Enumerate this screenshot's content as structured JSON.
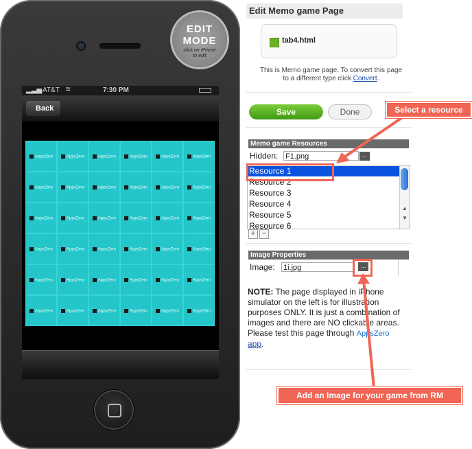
{
  "phone": {
    "status_carrier": "AT&T",
    "status_time": "7:30 PM",
    "back_label": "Back",
    "edit_seal_big1": "EDIT",
    "edit_seal_big2": "MODE",
    "edit_seal_small1": "click on iPhone",
    "edit_seal_small2": "to edit",
    "tile_brand": "AppsZero",
    "tile_count": 36
  },
  "panel": {
    "title": "Edit Memo game Page",
    "file_name": "tab4.html",
    "desc_text": "This is Memo game page. To convert this page to a different type click",
    "desc_link": "Convert",
    "save_label": "Save",
    "done_label": "Done"
  },
  "resources": {
    "header": "Memo game Resources",
    "hidden_label": "Hidden:",
    "hidden_value": "F1.png",
    "dots_label": "...",
    "items": [
      "Resource 1",
      "Resource 2",
      "Resource 3",
      "Resource 4",
      "Resource 5",
      "Resource 6"
    ],
    "selected_index": 0
  },
  "image_props": {
    "header": "Image Properties",
    "image_label": "Image:",
    "image_value": "1i.jpg",
    "dots_label": "..."
  },
  "note": {
    "bold": "NOTE:",
    "text": "The page displayed in iPhone simulator on the left is for illustration purposes ONLY. It is just a combination of images and there are NO clickable areas. Please test this page through",
    "brand": "AppsZero",
    "app_link": "app",
    "end": "."
  },
  "callouts": {
    "select_resource": "Select a resource",
    "add_image": "Add an Image for your game from RM"
  },
  "colors": {
    "accent_red": "#f06553",
    "tile": "#25c6c9",
    "save_green": "#4fae1c",
    "selection_blue": "#0a53e0"
  }
}
